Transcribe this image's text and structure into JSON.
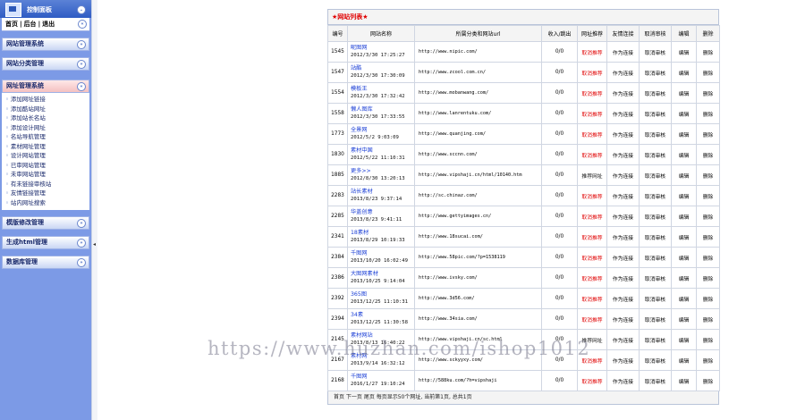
{
  "sidebar": {
    "title": "控制面板",
    "quick_links": [
      "首页",
      "后台",
      "退出"
    ],
    "quick_sep": "|",
    "sections": [
      {
        "label": "网站管理系统"
      },
      {
        "label": "网站分类管理"
      },
      {
        "label": "网址管理系统"
      },
      {
        "label": "模版修改管理"
      },
      {
        "label": "生成html管理"
      },
      {
        "label": "数据库管理"
      }
    ],
    "submenu": [
      "添加网址链接",
      "添加酷站网址",
      "添加站长名站",
      "添加设计网址",
      "名站导航管理",
      "素材网址管理",
      "设计网站管理",
      "已审网站管理",
      "未审网站管理",
      "有未链接审核站",
      "友情链接管理",
      "站内网址搜索"
    ]
  },
  "main": {
    "title": "★网站列表★",
    "columns": [
      "编号",
      "网站名称",
      "所属分类和网站url",
      "收入/跳出",
      "网址推荐",
      "友情连接",
      "取消审核",
      "编辑",
      "删除"
    ],
    "rows": [
      {
        "id": "1545",
        "name": "昵图网",
        "date": "2012/3/30 17:25:27",
        "url": "http://www.nipic.com/",
        "ratio": "0/0",
        "recommend": "取消推荐",
        "rec_red": true,
        "link": "作为连接",
        "cancel": "取消审核",
        "edit": "编辑",
        "del": "删除"
      },
      {
        "id": "1547",
        "name": "站酷",
        "date": "2012/3/30 17:30:09",
        "url": "http://www.zcool.com.cn/",
        "ratio": "0/0",
        "recommend": "取消推荐",
        "rec_red": true,
        "link": "作为连接",
        "cancel": "取消审核",
        "edit": "编辑",
        "del": "删除"
      },
      {
        "id": "1554",
        "name": "模板王",
        "date": "2012/3/30 17:32:42",
        "url": "http://www.mobanwang.com/",
        "ratio": "0/0",
        "recommend": "取消推荐",
        "rec_red": true,
        "link": "作为连接",
        "cancel": "取消审核",
        "edit": "编辑",
        "del": "删除"
      },
      {
        "id": "1558",
        "name": "懒人图库",
        "date": "2012/3/30 17:33:55",
        "url": "http://www.lanrentuku.com/",
        "ratio": "0/0",
        "recommend": "取消推荐",
        "rec_red": true,
        "link": "作为连接",
        "cancel": "取消审核",
        "edit": "编辑",
        "del": "删除"
      },
      {
        "id": "1773",
        "name": "全景网",
        "date": "2012/5/2 9:03:09",
        "url": "http://www.quanjing.com/",
        "ratio": "0/0",
        "recommend": "取消推荐",
        "rec_red": true,
        "link": "作为连接",
        "cancel": "取消审核",
        "edit": "编辑",
        "del": "删除"
      },
      {
        "id": "1830",
        "name": "素材中国",
        "date": "2012/5/22 11:10:31",
        "url": "http://www.sccnn.com/",
        "ratio": "0/0",
        "recommend": "取消推荐",
        "rec_red": true,
        "link": "作为连接",
        "cancel": "取消审核",
        "edit": "编辑",
        "del": "删除"
      },
      {
        "id": "1885",
        "name": "更多>>",
        "date": "2012/8/30 13:20:13",
        "url": "http://www.vipshaji.cn/html/10140.htm",
        "ratio": "0/0",
        "recommend": "推荐网址",
        "rec_red": false,
        "link": "作为连接",
        "cancel": "取消审核",
        "edit": "编辑",
        "del": "删除"
      },
      {
        "id": "2283",
        "name": "站长素材",
        "date": "2013/8/23 9:37:14",
        "url": "http://sc.chinaz.com/",
        "ratio": "0/0",
        "recommend": "取消推荐",
        "rec_red": true,
        "link": "作为连接",
        "cancel": "取消审核",
        "edit": "编辑",
        "del": "删除"
      },
      {
        "id": "2285",
        "name": "华盖创意",
        "date": "2013/8/23 9:41:11",
        "url": "http://www.gettyimages.cn/",
        "ratio": "0/0",
        "recommend": "取消推荐",
        "rec_red": true,
        "link": "作为连接",
        "cancel": "取消审核",
        "edit": "编辑",
        "del": "删除"
      },
      {
        "id": "2341",
        "name": "18素材",
        "date": "2013/8/29 10:19:33",
        "url": "http://www.18sucai.com/",
        "ratio": "0/0",
        "recommend": "取消推荐",
        "rec_red": true,
        "link": "作为连接",
        "cancel": "取消审核",
        "edit": "编辑",
        "del": "删除"
      },
      {
        "id": "2384",
        "name": "千图网",
        "date": "2013/10/20 16:02:49",
        "url": "http://www.58pic.com/?p=1538119",
        "ratio": "0/0",
        "recommend": "取消推荐",
        "rec_red": true,
        "link": "作为连接",
        "cancel": "取消审核",
        "edit": "编辑",
        "del": "删除"
      },
      {
        "id": "2386",
        "name": "大图网素材",
        "date": "2013/10/25 9:14:04",
        "url": "http://www.ivsky.com/",
        "ratio": "0/0",
        "recommend": "取消推荐",
        "rec_red": true,
        "link": "作为连接",
        "cancel": "取消审核",
        "edit": "编辑",
        "del": "删除"
      },
      {
        "id": "2392",
        "name": "365图",
        "date": "2013/12/25 11:10:31",
        "url": "http://www.3d56.com/",
        "ratio": "0/0",
        "recommend": "取消推荐",
        "rec_red": true,
        "link": "作为连接",
        "cancel": "取消审核",
        "edit": "编辑",
        "del": "删除"
      },
      {
        "id": "2394",
        "name": "34素",
        "date": "2013/12/25 11:30:58",
        "url": "http://www.34sia.com/",
        "ratio": "0/0",
        "recommend": "取消推荐",
        "rec_red": true,
        "link": "作为连接",
        "cancel": "取消审核",
        "edit": "编辑",
        "del": "删除"
      },
      {
        "id": "2145",
        "name": "素材网站",
        "date": "2013/8/13 16:40:22",
        "url": "http://www.vipshaji.cn/sc.html",
        "ratio": "0/0",
        "recommend": "推荐网址",
        "rec_red": false,
        "link": "作为连接",
        "cancel": "取消审核",
        "edit": "编辑",
        "del": "删除"
      },
      {
        "id": "2167",
        "name": "素材网",
        "date": "2013/9/14 16:32:12",
        "url": "http://www.sckyyxy.com/",
        "ratio": "0/0",
        "recommend": "取消推荐",
        "rec_red": true,
        "link": "作为连接",
        "cancel": "取消审核",
        "edit": "编辑",
        "del": "删除"
      },
      {
        "id": "2168",
        "name": "千图网",
        "date": "2016/1/27 19:10:24",
        "url": "http://588ku.com/?h=vipshaji",
        "ratio": "0/0",
        "recommend": "取消推荐",
        "rec_red": true,
        "link": "作为连接",
        "cancel": "取消审核",
        "edit": "编辑",
        "del": "删除"
      }
    ],
    "footer": "首页  下一页  尾页  每页显示50个网址, 当前第1页, 总共1页"
  },
  "watermark": "https://www.huzhan.com/ishop1012",
  "colors": {
    "sidebar_bg": "#7c9ae6",
    "accent_red": "#e00000",
    "link_blue": "#1b3fd6"
  }
}
